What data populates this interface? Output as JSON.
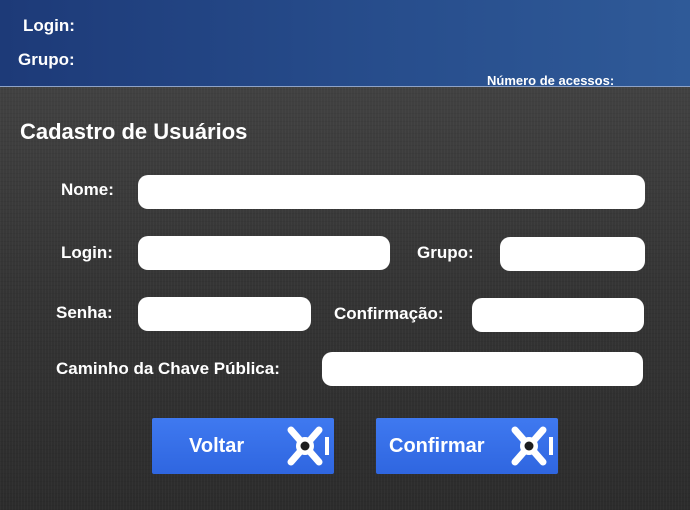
{
  "header": {
    "login_label": "Login:",
    "grupo_label": "Grupo:",
    "acessos_label": "Número de acessos:"
  },
  "form": {
    "title": "Cadastro de Usuários",
    "nome_label": "Nome:",
    "nome_value": "",
    "login_label": "Login:",
    "login_value": "",
    "grupo_label": "Grupo:",
    "grupo_value": "",
    "senha_label": "Senha:",
    "senha_value": "",
    "confirmacao_label": "Confirmação:",
    "confirmacao_value": "",
    "chave_label": "Caminho da Chave Pública:",
    "chave_value": ""
  },
  "buttons": {
    "voltar_label": "Voltar",
    "confirmar_label": "Confirmar",
    "icon": "safe-dial-icon"
  },
  "colors": {
    "header_blue": "#254a8a",
    "button_blue": "#3570e8",
    "text": "#ffffff"
  }
}
